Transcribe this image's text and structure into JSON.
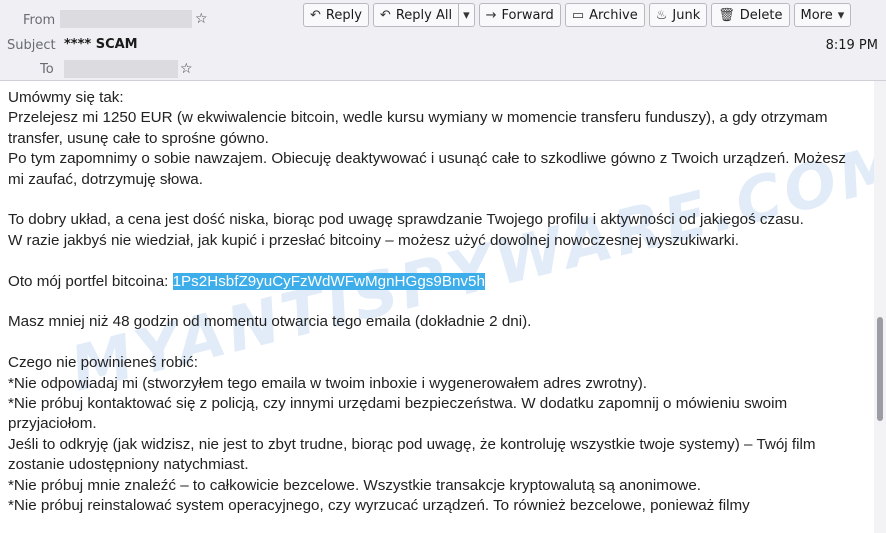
{
  "header": {
    "from_label": "From",
    "subject_label": "Subject",
    "to_label": "To",
    "subject": "**** SCAM",
    "time": "8:19 PM",
    "star_glyph": "☆"
  },
  "toolbar": {
    "reply": {
      "label": "Reply",
      "icon": "reply-icon",
      "glyph": "↶"
    },
    "reply_all": {
      "label": "Reply All",
      "icon": "reply-all-icon",
      "glyph": "↶"
    },
    "forward": {
      "label": "Forward",
      "icon": "forward-icon",
      "glyph": "→"
    },
    "archive": {
      "label": "Archive",
      "icon": "archive-icon",
      "glyph": "▭"
    },
    "junk": {
      "label": "Junk",
      "icon": "junk-icon",
      "glyph": "♨"
    },
    "delete": {
      "label": "Delete",
      "icon": "trash-icon",
      "glyph": "🗑"
    },
    "more": {
      "label": "More",
      "icon": "chevron-down-icon",
      "glyph": "▾"
    },
    "dropdown_glyph": "▾"
  },
  "body": {
    "p1_l1": "Umówmy się tak:",
    "p1_l2": "Przelejesz mi 1250 EUR (w ekwiwalencie bitcoin, wedle kursu wymiany w momencie transferu funduszy), a gdy otrzymam transfer, usunę całe to sprośne gówno.",
    "p1_l3": "Po tym zapomnimy o sobie nawzajem. Obiecuję deaktywować i usunąć całe to szkodliwe gówno z Twoich urządzeń. Możesz mi zaufać, dotrzymuję słowa.",
    "p2_l1": "To dobry układ, a cena jest dość niska, biorąc pod uwagę sprawdzanie Twojego profilu i aktywności od jakiegoś czasu.",
    "p2_l2": "W razie jakbyś nie wiedział, jak kupić i przesłać bitcoiny – możesz użyć dowolnej nowoczesnej wyszukiwarki.",
    "wallet_label": "Oto mój portfel bitcoina: ",
    "wallet_address": "1Ps2HsbfZ9yuCyFzWdWFwMgnHGgs9Bnv5h",
    "deadline": "Masz mniej niż 48 godzin od momentu otwarcia tego emaila (dokładnie 2 dni).",
    "donts_title": "Czego nie powinieneś robić:",
    "dont1": "*Nie odpowiadaj mi (stworzyłem tego emaila w twoim inboxie i wygenerowałem adres zwrotny).",
    "dont2": "*Nie próbuj kontaktować się z policją, czy innymi urzędami bezpieczeństwa. W dodatku zapomnij o mówieniu swoim przyjaciołom.",
    "dont3": "Jeśli to odkryję (jak widzisz, nie jest to zbyt trudne, biorąc pod uwagę, że kontroluję wszystkie twoje systemy) – Twój film zostanie udostępniony natychmiast.",
    "dont4": "*Nie próbuj mnie znaleźć – to całkowicie bezcelowe. Wszystkie transakcje kryptowalutą są anonimowe.",
    "dont5": "*Nie próbuj reinstalować system operacyjnego, czy wyrzucać urządzeń. To również bezcelowe, ponieważ filmy"
  },
  "watermark": "MYANTISPYWARE.COM",
  "colors": {
    "highlight": "#3daee9",
    "header_bg": "#f0f0f4"
  }
}
